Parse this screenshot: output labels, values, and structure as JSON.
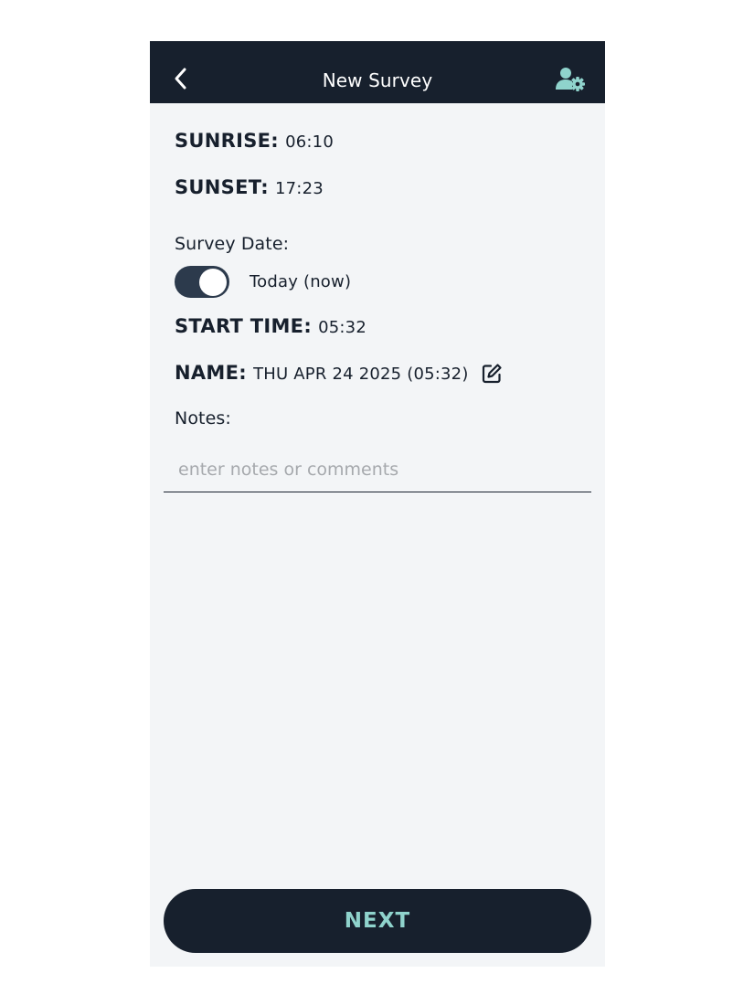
{
  "header": {
    "title": "New Survey",
    "back_icon": "chevron-left-icon",
    "settings_icon": "user-gear-icon"
  },
  "sun": {
    "sunrise_label": "SUNRISE:",
    "sunrise_value": "06:10",
    "sunset_label": "SUNSET:",
    "sunset_value": "17:23"
  },
  "survey_date": {
    "label": "Survey Date:",
    "toggle_on": true,
    "toggle_text": "Today (now)"
  },
  "start_time": {
    "label": "START TIME:",
    "value": "05:32"
  },
  "name": {
    "label": "NAME:",
    "value": "THU APR 24 2025 (05:32)",
    "edit_icon": "edit-icon"
  },
  "notes": {
    "label": "Notes:",
    "placeholder": "enter notes or comments",
    "value": ""
  },
  "footer": {
    "next_label": "NEXT"
  },
  "colors": {
    "header_bg": "#17202d",
    "screen_bg": "#f3f5f7",
    "accent": "#8fd3cc",
    "toggle_track": "#2c3a4c"
  }
}
